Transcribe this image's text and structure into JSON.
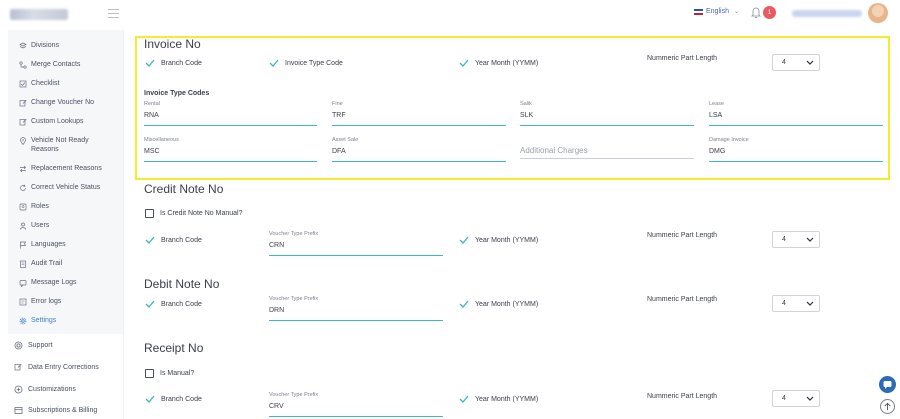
{
  "header": {
    "language": "English",
    "notification_count": "1"
  },
  "sidebar": {
    "sub_items": [
      {
        "label": "Divisions",
        "icon": "layers-icon"
      },
      {
        "label": "Merge Contacts",
        "icon": "merge-icon"
      },
      {
        "label": "Checklist",
        "icon": "checklist-icon"
      },
      {
        "label": "Change Voucher No",
        "icon": "edit-icon"
      },
      {
        "label": "Custom Lookups",
        "icon": "edit-icon"
      },
      {
        "label": "Vehicle Not Ready Reasons",
        "icon": "location-pin-icon"
      },
      {
        "label": "Replacement Reasons",
        "icon": "swap-icon"
      },
      {
        "label": "Correct Vehicle Status",
        "icon": "refresh-icon"
      },
      {
        "label": "Roles",
        "icon": "roles-icon"
      },
      {
        "label": "Users",
        "icon": "user-icon"
      },
      {
        "label": "Languages",
        "icon": "flag-icon"
      },
      {
        "label": "Audit Trail",
        "icon": "audit-icon"
      },
      {
        "label": "Message Logs",
        "icon": "message-icon"
      },
      {
        "label": "Error logs",
        "icon": "error-icon"
      },
      {
        "label": "Settings",
        "icon": "gear-icon"
      }
    ],
    "main_items": [
      {
        "label": "Support",
        "icon": "support-icon"
      },
      {
        "label": "Data Entry Corrections",
        "icon": "edit-icon"
      },
      {
        "label": "Customizations",
        "icon": "plus-circle-icon"
      },
      {
        "label": "Subscriptions & Billing",
        "icon": "billing-icon"
      }
    ]
  },
  "invoice": {
    "title": "Invoice No",
    "branch_code": "Branch Code",
    "invoice_type_code": "Invoice Type Code",
    "year_month": "Year Month (YYMM)",
    "numeric_part_label": "Nummeric Part Length",
    "numeric_part_value": "4",
    "codes_heading": "Invoice Type Codes",
    "codes": {
      "rental": {
        "caption": "Rental",
        "value": "RNA"
      },
      "fine": {
        "caption": "Fine",
        "value": "TRF"
      },
      "salik": {
        "caption": "Salik",
        "value": "SLK"
      },
      "lease": {
        "caption": "Lease",
        "value": "LSA"
      },
      "misc": {
        "caption": "Miscellaneous",
        "value": "MSC"
      },
      "asset": {
        "caption": "Asset Sale",
        "value": "DFA"
      },
      "additional": {
        "placeholder": "Additional Charges"
      },
      "damage": {
        "caption": "Damage Invoice",
        "value": "DMG"
      }
    }
  },
  "credit": {
    "title": "Credit Note No",
    "manual_label": "Is Credit Note No Manual?",
    "branch_code": "Branch Code",
    "prefix_caption": "Voucher Type Prefix",
    "prefix_value": "CRN",
    "year_month": "Year Month (YYMM)",
    "numeric_part_label": "Nummeric Part Length",
    "numeric_part_value": "4"
  },
  "debit": {
    "title": "Debit Note No",
    "branch_code": "Branch Code",
    "prefix_caption": "Voucher Type Prefix",
    "prefix_value": "DRN",
    "year_month": "Year Month (YYMM)",
    "numeric_part_label": "Nummeric Part Length",
    "numeric_part_value": "4"
  },
  "receipt": {
    "title": "Receipt No",
    "manual_label": "Is Manual?",
    "branch_code": "Branch Code",
    "prefix_caption": "Voucher Type Prefix",
    "prefix_value": "CRV",
    "year_month": "Year Month (YYMM)",
    "numeric_part_label": "Nummeric Part Length",
    "numeric_part_value": "4"
  },
  "colors": {
    "accent": "#3fb7c0",
    "highlight": "#f1ef2c",
    "badge": "#e95a63",
    "chat": "#2b6cb5"
  }
}
